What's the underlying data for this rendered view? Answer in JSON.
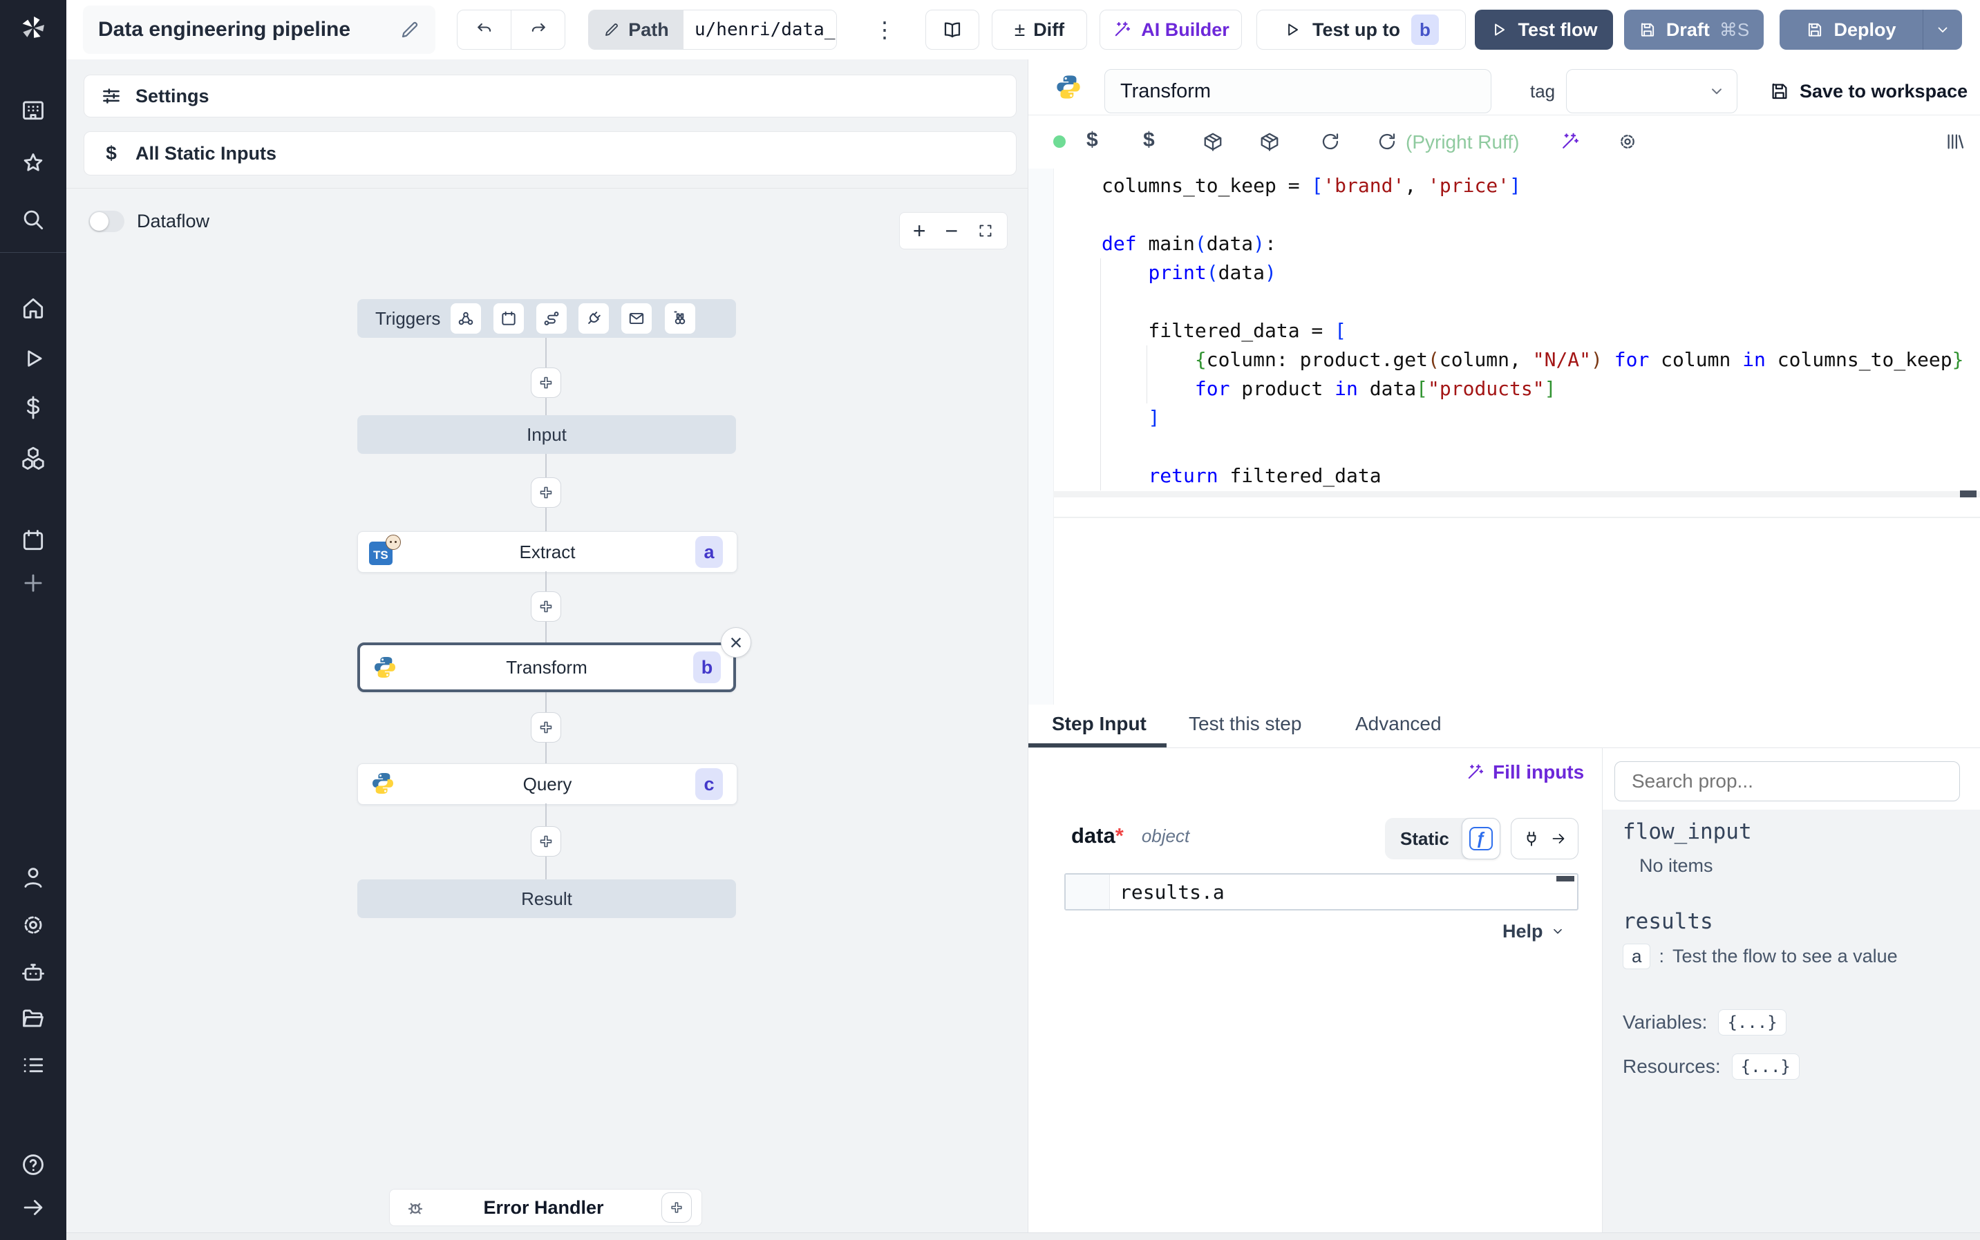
{
  "colors": {
    "sidebar_bg": "#1d222e",
    "accent_purple": "#6d28d9",
    "test_flow_bg": "#3e4e6b",
    "deploy_bg": "#6d82a6",
    "node_bar_bg": "#dbe2ea",
    "badge_bg": "#dfe3fb",
    "badge_text": "#4338ca",
    "selected_border": "#4e5e74",
    "lint_green": "#8fca9f",
    "status_green": "#6fdc95",
    "kw_blue": "#0000ff",
    "str_red": "#a31515",
    "bracket_blue": "#0431fa",
    "bracket_green": "#319331",
    "bracket_brown": "#7b3814",
    "python_blue": "#3776ab",
    "python_yellow": "#ffd43b",
    "ts_blue": "#3178c6",
    "fn_blue": "#2f6fed",
    "red_asterisk": "#ef4444"
  },
  "icons": {
    "diff_glyph": "±",
    "kebab_glyph": "⋮",
    "close_glyph": "×",
    "fn_glyph": "ƒ",
    "dollar_glyph": "$",
    "plus_glyph": "+",
    "minus_glyph": "−"
  },
  "app": {
    "title": "Data engineering pipeline",
    "path_label": "Path",
    "path_value": "u/henri/data_"
  },
  "topbar": {
    "diff_label": "Diff",
    "ai_builder_label": "AI Builder",
    "test_up_to_label": "Test up to",
    "test_up_to_badge": "b",
    "test_flow_label": "Test flow",
    "draft_label": "Draft",
    "draft_shortcut": "⌘S",
    "deploy_label": "Deploy"
  },
  "flow": {
    "settings_label": "Settings",
    "all_static_inputs_label": "All Static Inputs",
    "dataflow_label": "Dataflow",
    "triggers_label": "Triggers",
    "trigger_icons": [
      "webhook",
      "schedule",
      "route",
      "websocket",
      "email",
      "poll"
    ],
    "nodes": {
      "input": {
        "label": "Input"
      },
      "extract": {
        "label": "Extract",
        "badge": "a",
        "language": "bun"
      },
      "transform": {
        "label": "Transform",
        "badge": "b",
        "language": "python"
      },
      "query": {
        "label": "Query",
        "badge": "c",
        "language": "python"
      },
      "result": {
        "label": "Result"
      }
    },
    "error_handler_label": "Error Handler"
  },
  "editor": {
    "step_name": "Transform",
    "tag_label": "tag",
    "save_label": "Save to workspace",
    "lint_label": "(Pyright Ruff)",
    "code_lines": [
      [
        [
          "p",
          "columns_to_keep = "
        ],
        [
          "b1",
          "["
        ],
        [
          "s",
          "'brand'"
        ],
        [
          "p",
          ", "
        ],
        [
          "s",
          "'price'"
        ],
        [
          "b1",
          "]"
        ]
      ],
      [],
      [
        [
          "k",
          "def"
        ],
        [
          "p",
          " main"
        ],
        [
          "b1",
          "("
        ],
        [
          "p",
          "data"
        ],
        [
          "b1",
          ")"
        ],
        [
          "p",
          ":"
        ]
      ],
      [
        [
          "p",
          "    "
        ],
        [
          "k",
          "print"
        ],
        [
          "b1",
          "("
        ],
        [
          "p",
          "data"
        ],
        [
          "b1",
          ")"
        ]
      ],
      [],
      [
        [
          "p",
          "    filtered_data = "
        ],
        [
          "b1",
          "["
        ]
      ],
      [
        [
          "p",
          "        "
        ],
        [
          "b2",
          "{"
        ],
        [
          "p",
          "column: product.get"
        ],
        [
          "b3",
          "("
        ],
        [
          "p",
          "column, "
        ],
        [
          "s",
          "\"N/A\""
        ],
        [
          "b3",
          ")"
        ],
        [
          "p",
          " "
        ],
        [
          "k",
          "for"
        ],
        [
          "p",
          " column "
        ],
        [
          "k",
          "in"
        ],
        [
          "p",
          " columns_to_keep"
        ],
        [
          "b2",
          "}"
        ]
      ],
      [
        [
          "p",
          "        "
        ],
        [
          "k",
          "for"
        ],
        [
          "p",
          " product "
        ],
        [
          "k",
          "in"
        ],
        [
          "p",
          " data"
        ],
        [
          "b2",
          "["
        ],
        [
          "s",
          "\"products\""
        ],
        [
          "b2",
          "]"
        ]
      ],
      [
        [
          "p",
          "    "
        ],
        [
          "b1",
          "]"
        ]
      ],
      [],
      [
        [
          "p",
          "    "
        ],
        [
          "k",
          "return"
        ],
        [
          "p",
          " filtered_data"
        ]
      ]
    ]
  },
  "tabs": {
    "step_input": "Step Input",
    "test_this_step": "Test this step",
    "advanced": "Advanced"
  },
  "step_input": {
    "fill_inputs_label": "Fill inputs",
    "arg_name": "data",
    "required_mark": "*",
    "arg_type": "object",
    "static_label": "Static",
    "expression": "results.a",
    "help_label": "Help"
  },
  "props": {
    "search_placeholder": "Search prop...",
    "flow_input_label": "flow_input",
    "no_items_label": "No items",
    "results_label": "results",
    "result_key": "a",
    "result_separator": ":",
    "result_hint": "Test the flow to see a value",
    "variables_label": "Variables:",
    "variables_value": "{...}",
    "resources_label": "Resources:",
    "resources_value": "{...}"
  }
}
